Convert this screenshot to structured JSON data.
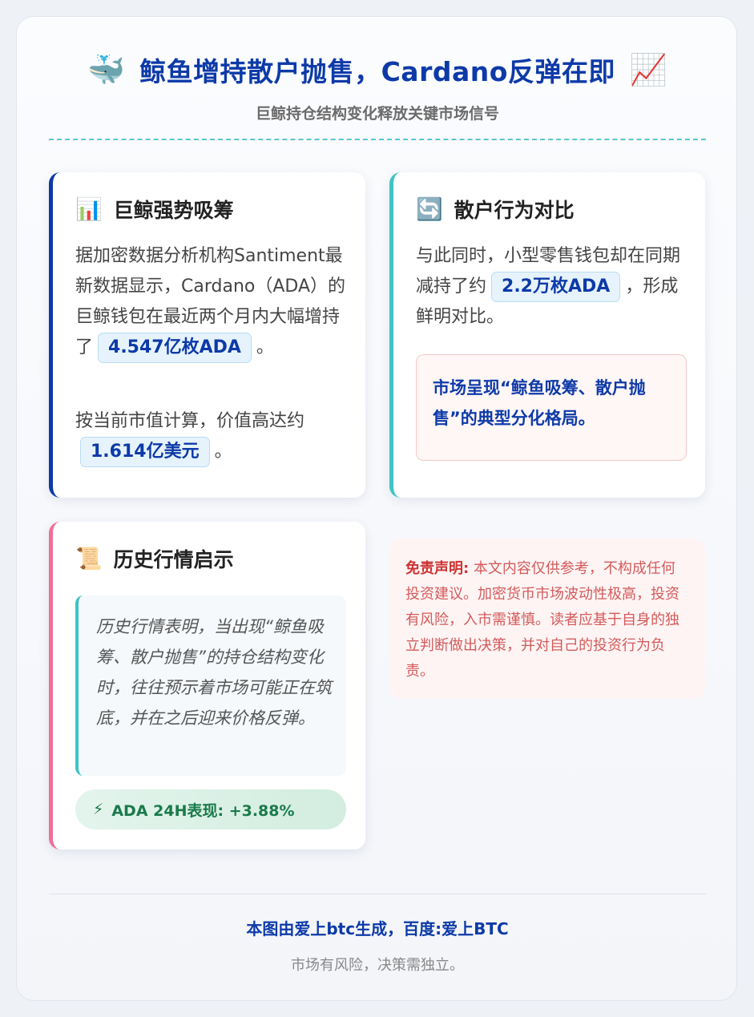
{
  "header": {
    "title_icon": "whale-emoji",
    "title": "鲸鱼增持散户抛售，Cardano反弹在即",
    "title_trailing_icon": "chart-increasing-emoji",
    "subtitle": "巨鲸持仓结构变化释放关键市场信号"
  },
  "cards": {
    "whale": {
      "icon": "bar-chart-emoji",
      "heading": "巨鲸强势吸筹",
      "text1": "据加密数据分析机构Santiment最新数据显示，Cardano（ADA）的巨鲸钱包在最近两个月内大幅增持了",
      "pill1": "4.547亿枚ADA",
      "text1_end": "。",
      "text2": "按当前市值计算，价值高达约",
      "pill2": "1.614亿美元",
      "text2_end": "。"
    },
    "retail": {
      "icon": "refresh-arrows-emoji",
      "heading": "散户行为对比",
      "text1": "与此同时，小型零售钱包却在同期减持了约",
      "pill1": "2.2万枚ADA",
      "text1_end": "，形成鲜明对比。",
      "alert": "市场呈现“鲸鱼吸筹、散户抛售”的典型分化格局。"
    },
    "history": {
      "icon": "scroll-emoji",
      "heading": "历史行情启示",
      "quote": "历史行情表明，当出现“鲸鱼吸筹、散户抛售”的持仓结构变化时，往往预示着市场可能正在筑底，并在之后迎来价格反弹。",
      "perf_icon": "lightning-emoji",
      "perf": "ADA 24H表现: +3.88%"
    }
  },
  "disclaimer": {
    "label": "免责声明:",
    "text": "本文内容仅供参考，不构成任何投资建议。加密货币市场波动性极高，投资有风险，入市需谨慎。读者应基于自身的独立判断做出决策，并对自己的投资行为负责。"
  },
  "footer": {
    "main": "本图由爱上btc生成，百度:爱上BTC",
    "sub": "市场有风险，决策需独立。"
  },
  "colors": {
    "primary": "#0d3aa8",
    "teal": "#3ec4c4",
    "pink": "#ef6f98",
    "danger": "#d35b5b",
    "positive": "#1a7a4a"
  }
}
